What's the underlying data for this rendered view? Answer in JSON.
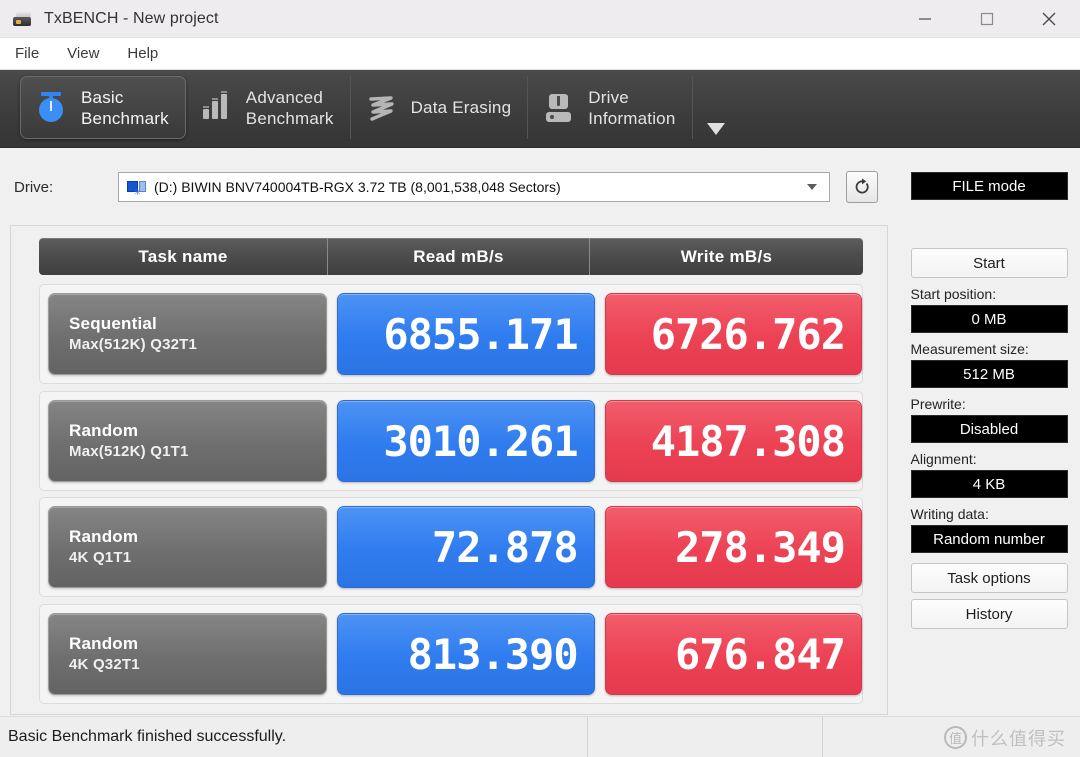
{
  "window": {
    "title": "TxBENCH - New project",
    "app_icon": "drive-icon",
    "controls": {
      "minimize": "minimize-icon",
      "maximize": "maximize-icon",
      "close": "close-icon"
    }
  },
  "menu": {
    "items": [
      {
        "label": "File"
      },
      {
        "label": "View"
      },
      {
        "label": "Help"
      }
    ]
  },
  "tabs": {
    "items": [
      {
        "label": "Basic\nBenchmark",
        "icon": "stopwatch-icon",
        "active": true
      },
      {
        "label": "Advanced\nBenchmark",
        "icon": "bar-chart-icon",
        "active": false
      },
      {
        "label": "Data Erasing",
        "icon": "shred-icon",
        "active": false
      },
      {
        "label": "Drive\nInformation",
        "icon": "drive-info-icon",
        "active": false
      }
    ],
    "overflow_icon": "chevron-down-icon"
  },
  "drive": {
    "label": "Drive:",
    "selected": "(D:) BIWIN BNV740004TB-RGX  3.72 TB (8,001,538,048 Sectors)",
    "dropdown_icon": "chevron-down-icon",
    "refresh_icon": "refresh-icon"
  },
  "results": {
    "headers": {
      "task": "Task name",
      "read": "Read mB/s",
      "write": "Write mB/s"
    },
    "rows": [
      {
        "task_line1": "Sequential",
        "task_line2": "Max(512K) Q32T1",
        "read": "6855.171",
        "write": "6726.762"
      },
      {
        "task_line1": "Random",
        "task_line2": "Max(512K) Q1T1",
        "read": "3010.261",
        "write": "4187.308"
      },
      {
        "task_line1": "Random",
        "task_line2": "4K Q1T1",
        "read": "72.878",
        "write": "278.349"
      },
      {
        "task_line1": "Random",
        "task_line2": "4K Q32T1",
        "read": "813.390",
        "write": "676.847"
      }
    ],
    "colors": {
      "read": "#2f7cef",
      "write": "#ec4254",
      "header": "#4b4b4b",
      "task": "#6f6f6f"
    }
  },
  "sidebar": {
    "mode_button": "FILE mode",
    "start_button": "Start",
    "start_position_label": "Start position:",
    "start_position_value": "0 MB",
    "measurement_size_label": "Measurement size:",
    "measurement_size_value": "512 MB",
    "prewrite_label": "Prewrite:",
    "prewrite_value": "Disabled",
    "alignment_label": "Alignment:",
    "alignment_value": "4 KB",
    "writing_data_label": "Writing data:",
    "writing_data_value": "Random number",
    "task_options_button": "Task options",
    "history_button": "History"
  },
  "status": {
    "message": "Basic Benchmark finished successfully.",
    "watermark_mark": "值",
    "watermark_text": "什么值得买"
  }
}
